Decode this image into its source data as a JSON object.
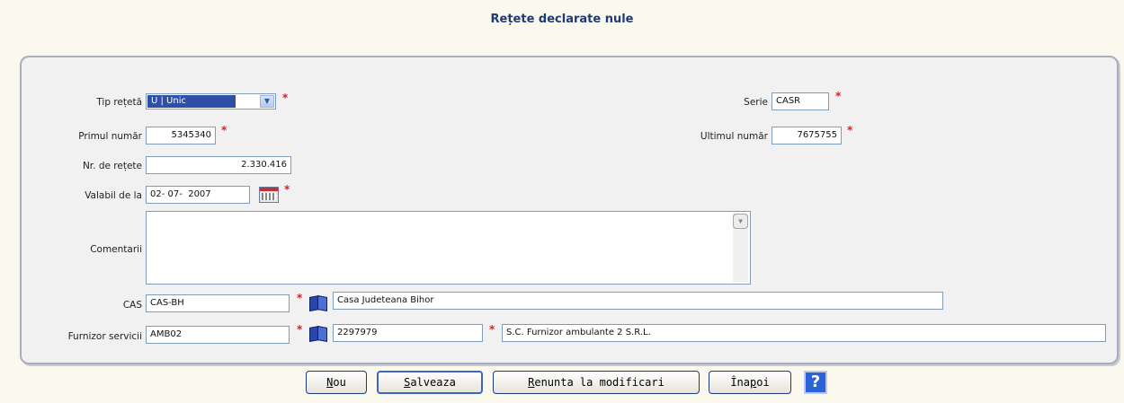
{
  "title": "Rețete declarate nule",
  "form": {
    "tip_reteta": {
      "label": "Tip rețetă",
      "value": "U | Unic"
    },
    "serie": {
      "label": "Serie",
      "value": "CASR"
    },
    "primul_numar": {
      "label": "Primul număr",
      "value": "5345340"
    },
    "ultimul_numar": {
      "label": "Ultimul număr",
      "value": "7675755"
    },
    "nr_retete": {
      "label": "Nr. de rețete",
      "value": "2.330.416"
    },
    "valabil": {
      "label": "Valabil de la",
      "value": "02- 07-  2007"
    },
    "comentarii": {
      "label": "Comentarii",
      "value": ""
    },
    "cas": {
      "label": "CAS",
      "code": "CAS-BH",
      "name": "Casa Judeteana Bihor"
    },
    "furnizor": {
      "label": "Furnizor servicii",
      "code": "AMB02",
      "id": "2297979",
      "name": "S.C. Furnizor ambulante 2 S.R.L."
    },
    "required_mark": "*"
  },
  "buttons": {
    "nou": {
      "u": "N",
      "rest": "ou"
    },
    "salveaza": {
      "u": "S",
      "rest": "alveaza"
    },
    "renunta": {
      "u": "R",
      "rest": "enunta la modificari"
    },
    "inapoi": {
      "pre": "Îna",
      "u": "p",
      "rest": "oi"
    },
    "help": "?"
  },
  "colors": {
    "accent": "#2d4fa8",
    "required": "#e01b1b",
    "title": "#1f3a78"
  }
}
